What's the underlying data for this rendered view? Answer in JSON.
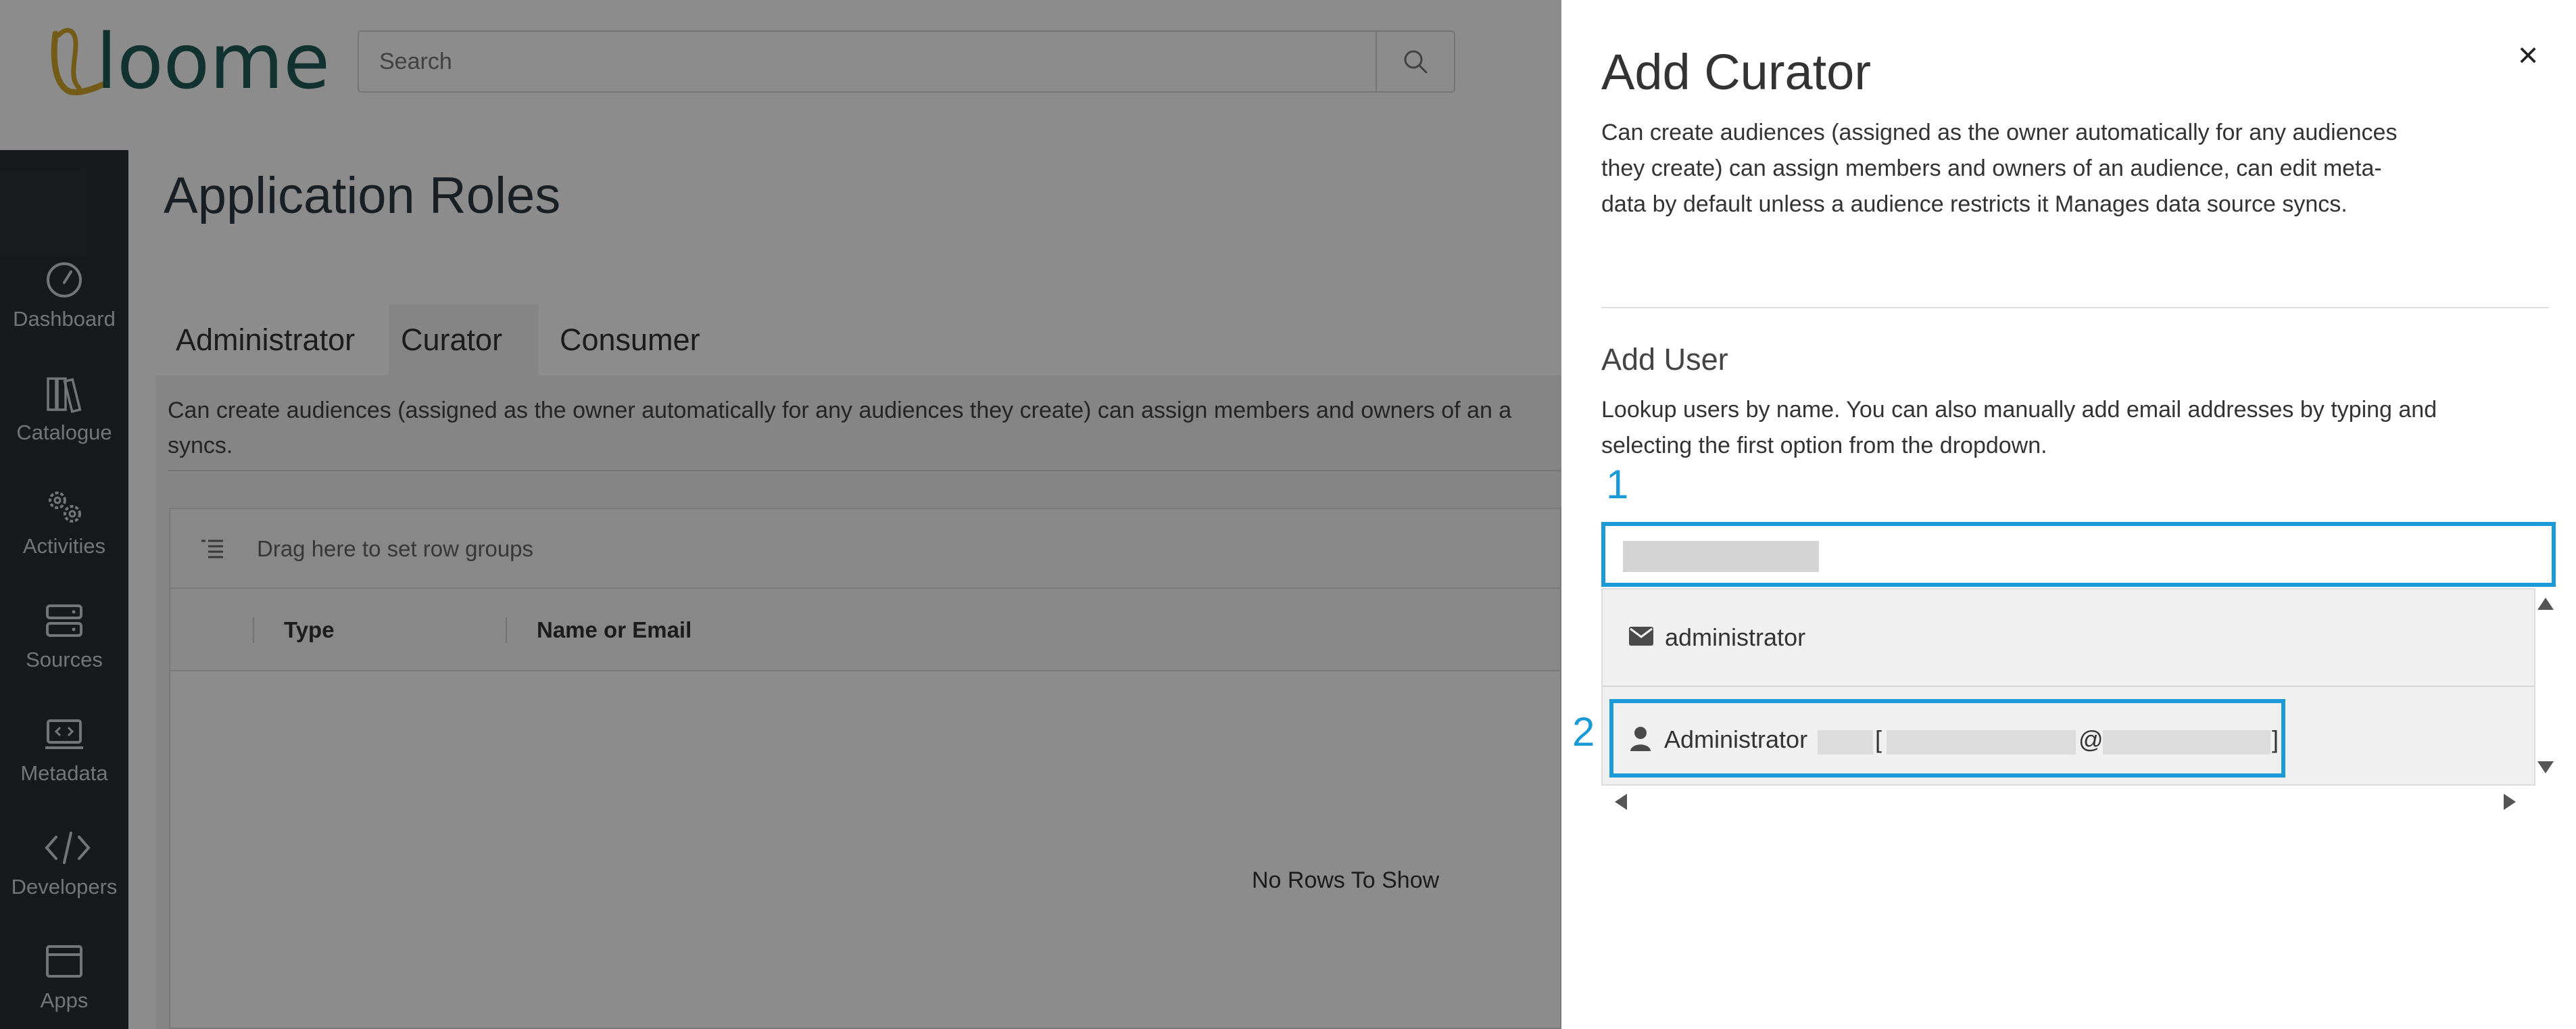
{
  "header": {
    "logo_text": "loome",
    "search": {
      "placeholder": "Search",
      "value": ""
    }
  },
  "sidebar": {
    "items": [
      {
        "label": "Dashboard",
        "icon": "dashboard-gauge-icon"
      },
      {
        "label": "Catalogue",
        "icon": "books-icon"
      },
      {
        "label": "Activities",
        "icon": "gears-icon"
      },
      {
        "label": "Sources",
        "icon": "server-icon"
      },
      {
        "label": "Metadata",
        "icon": "code-laptop-icon"
      },
      {
        "label": "Developers",
        "icon": "code-brackets-icon"
      },
      {
        "label": "Apps",
        "icon": "window-icon"
      }
    ]
  },
  "main": {
    "title": "Application Roles",
    "tabs": [
      {
        "label": "Administrator",
        "active": false
      },
      {
        "label": "Curator",
        "active": true
      },
      {
        "label": "Consumer",
        "active": false
      }
    ],
    "tab_description": "Can create audiences (assigned as the owner automatically for any audiences they create) can assign members and owners of an a syncs.",
    "grid": {
      "group_bar_text": "Drag here to set row groups",
      "columns": [
        "Type",
        "Name or Email"
      ],
      "empty_text": "No Rows To Show"
    }
  },
  "panel": {
    "close_label": "×",
    "title": "Add Curator",
    "description": "Can create audiences (assigned as the owner automatically for any audiences they create) can assign members and owners of an audience, can edit meta-data by default unless a audience restricts it Manages data source syncs.",
    "add_user_heading": "Add User",
    "add_user_description": "Lookup users by name. You can also manually add email addresses by typing and selecting the first option from the dropdown.",
    "step_1": "1",
    "step_2": "2",
    "dropdown": {
      "option_email": "administrator",
      "option_user_name": "Administrator",
      "option_user_open_bracket": "[",
      "option_user_at": "@",
      "option_user_close_bracket": "]"
    }
  },
  "colors": {
    "sidebar_bg": "#2b3035",
    "highlight_blue": "#1a9ad6",
    "overlay": "rgba(0,0,0,0.45)",
    "logo_gold": "#d4a72c",
    "logo_teal": "#1f5c5a"
  }
}
